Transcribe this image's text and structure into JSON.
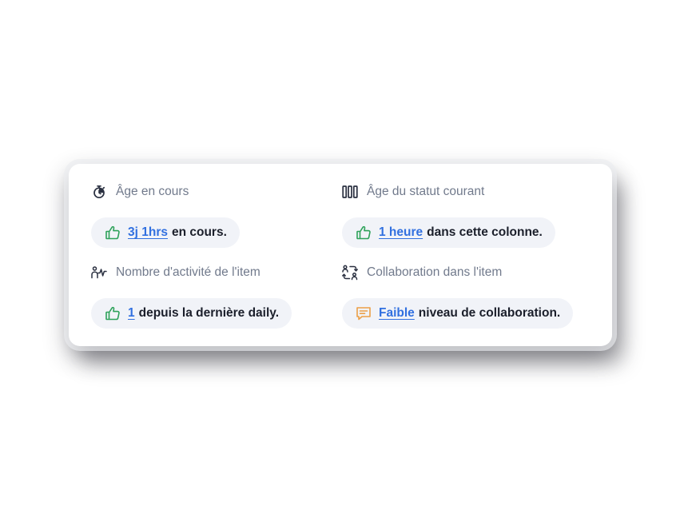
{
  "colors": {
    "link": "#3170e0",
    "positive": "#2ea25a",
    "warning": "#eca047",
    "label": "#717a8c",
    "text": "#1b1f2b",
    "pill_bg": "#f1f3f8"
  },
  "metrics": [
    {
      "icon": "stopwatch-icon",
      "label": "Âge en cours",
      "status_icon": "thumbs-up-icon",
      "value": "3j 1hrs",
      "description": "en cours."
    },
    {
      "icon": "kanban-columns-icon",
      "label": "Âge du statut courant",
      "status_icon": "thumbs-up-icon",
      "value": "1 heure",
      "description": "dans cette colonne."
    },
    {
      "icon": "person-activity-icon",
      "label": "Nombre d'activité de l'item",
      "status_icon": "thumbs-up-icon",
      "value": "1",
      "description": "depuis la dernière daily."
    },
    {
      "icon": "collaboration-users-icon",
      "label": "Collaboration dans l'item",
      "status_icon": "chat-bubble-icon",
      "value": "Faible",
      "description": "niveau de collaboration."
    }
  ]
}
